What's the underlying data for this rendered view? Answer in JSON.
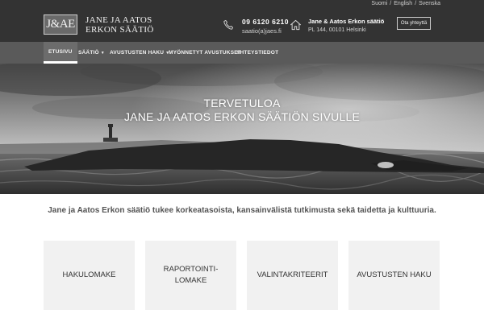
{
  "header": {
    "languages": [
      "Suomi",
      "English",
      "Svenska"
    ],
    "language_separator": "/",
    "logo_text": "J&AE",
    "org_name_line1": "JANE JA AATOS",
    "org_name_line2": "ERKON SÄÄTIÖ",
    "phone": "09 6120 6210",
    "email": "saatio(a)jaes.fi",
    "address_name": "Jane & Aatos Erkon säätiö",
    "address_line": "PL 144, 00101 Helsinki",
    "contact_button": "Ota yhteyttä"
  },
  "nav": {
    "items": [
      {
        "label": "ETUSIVU",
        "active": true,
        "has_dropdown": false
      },
      {
        "label": "SÄÄTIÖ",
        "active": false,
        "has_dropdown": true
      },
      {
        "label": "AVUSTUSTEN HAKU",
        "active": false,
        "has_dropdown": true
      },
      {
        "label": "MYÖNNETYT AVUSTUKSET",
        "active": false,
        "has_dropdown": false
      },
      {
        "label": "YHTEYSTIEDOT",
        "active": false,
        "has_dropdown": false
      }
    ]
  },
  "hero": {
    "line1": "TERVETULOA",
    "line2": "JANE JA AATOS ERKON SÄÄTIÖN SIVULLE"
  },
  "intro": {
    "text": "Jane ja Aatos Erkon säätiö tukee korkeatasoista, kansainvälistä tutkimusta sekä taidetta ja kulttuuria."
  },
  "tiles": [
    {
      "lines": [
        "HAKULOMAKE"
      ]
    },
    {
      "lines": [
        "RAPORTOINTI-",
        "LOMAKE"
      ]
    },
    {
      "lines": [
        "VALINTAKRITEERIT"
      ]
    },
    {
      "lines": [
        "AVUSTUSTEN HAKU"
      ]
    }
  ],
  "icons": {
    "phone": "phone-icon",
    "home": "home-icon",
    "dropdown": "caret-down-icon"
  },
  "colors": {
    "header_bg": "#333333",
    "nav_bg": "#5a5a5a",
    "tile_bg": "#f1f1f1",
    "text": "#555555"
  }
}
